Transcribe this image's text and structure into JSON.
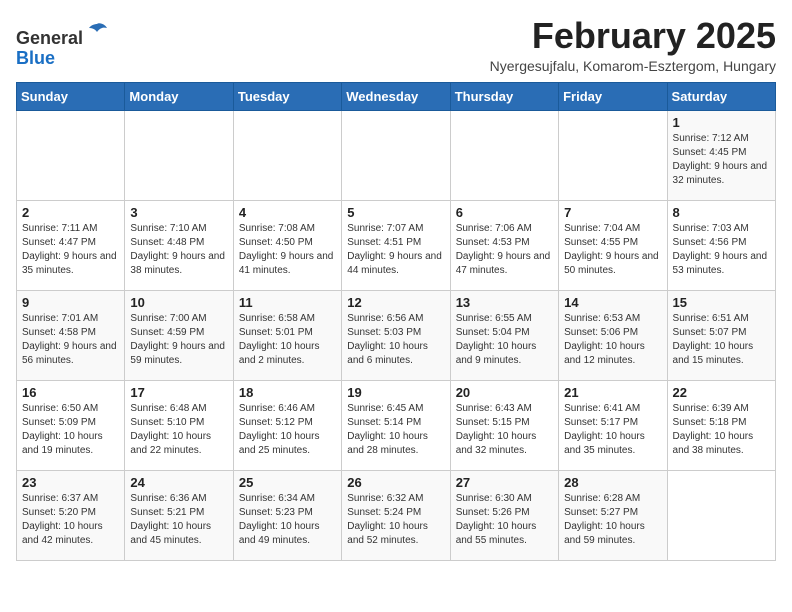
{
  "header": {
    "logo_general": "General",
    "logo_blue": "Blue",
    "title": "February 2025",
    "subtitle": "Nyergesujfalu, Komarom-Esztergom, Hungary"
  },
  "days_of_week": [
    "Sunday",
    "Monday",
    "Tuesday",
    "Wednesday",
    "Thursday",
    "Friday",
    "Saturday"
  ],
  "weeks": [
    [
      {
        "day": "",
        "info": ""
      },
      {
        "day": "",
        "info": ""
      },
      {
        "day": "",
        "info": ""
      },
      {
        "day": "",
        "info": ""
      },
      {
        "day": "",
        "info": ""
      },
      {
        "day": "",
        "info": ""
      },
      {
        "day": "1",
        "info": "Sunrise: 7:12 AM\nSunset: 4:45 PM\nDaylight: 9 hours and 32 minutes."
      }
    ],
    [
      {
        "day": "2",
        "info": "Sunrise: 7:11 AM\nSunset: 4:47 PM\nDaylight: 9 hours and 35 minutes."
      },
      {
        "day": "3",
        "info": "Sunrise: 7:10 AM\nSunset: 4:48 PM\nDaylight: 9 hours and 38 minutes."
      },
      {
        "day": "4",
        "info": "Sunrise: 7:08 AM\nSunset: 4:50 PM\nDaylight: 9 hours and 41 minutes."
      },
      {
        "day": "5",
        "info": "Sunrise: 7:07 AM\nSunset: 4:51 PM\nDaylight: 9 hours and 44 minutes."
      },
      {
        "day": "6",
        "info": "Sunrise: 7:06 AM\nSunset: 4:53 PM\nDaylight: 9 hours and 47 minutes."
      },
      {
        "day": "7",
        "info": "Sunrise: 7:04 AM\nSunset: 4:55 PM\nDaylight: 9 hours and 50 minutes."
      },
      {
        "day": "8",
        "info": "Sunrise: 7:03 AM\nSunset: 4:56 PM\nDaylight: 9 hours and 53 minutes."
      }
    ],
    [
      {
        "day": "9",
        "info": "Sunrise: 7:01 AM\nSunset: 4:58 PM\nDaylight: 9 hours and 56 minutes."
      },
      {
        "day": "10",
        "info": "Sunrise: 7:00 AM\nSunset: 4:59 PM\nDaylight: 9 hours and 59 minutes."
      },
      {
        "day": "11",
        "info": "Sunrise: 6:58 AM\nSunset: 5:01 PM\nDaylight: 10 hours and 2 minutes."
      },
      {
        "day": "12",
        "info": "Sunrise: 6:56 AM\nSunset: 5:03 PM\nDaylight: 10 hours and 6 minutes."
      },
      {
        "day": "13",
        "info": "Sunrise: 6:55 AM\nSunset: 5:04 PM\nDaylight: 10 hours and 9 minutes."
      },
      {
        "day": "14",
        "info": "Sunrise: 6:53 AM\nSunset: 5:06 PM\nDaylight: 10 hours and 12 minutes."
      },
      {
        "day": "15",
        "info": "Sunrise: 6:51 AM\nSunset: 5:07 PM\nDaylight: 10 hours and 15 minutes."
      }
    ],
    [
      {
        "day": "16",
        "info": "Sunrise: 6:50 AM\nSunset: 5:09 PM\nDaylight: 10 hours and 19 minutes."
      },
      {
        "day": "17",
        "info": "Sunrise: 6:48 AM\nSunset: 5:10 PM\nDaylight: 10 hours and 22 minutes."
      },
      {
        "day": "18",
        "info": "Sunrise: 6:46 AM\nSunset: 5:12 PM\nDaylight: 10 hours and 25 minutes."
      },
      {
        "day": "19",
        "info": "Sunrise: 6:45 AM\nSunset: 5:14 PM\nDaylight: 10 hours and 28 minutes."
      },
      {
        "day": "20",
        "info": "Sunrise: 6:43 AM\nSunset: 5:15 PM\nDaylight: 10 hours and 32 minutes."
      },
      {
        "day": "21",
        "info": "Sunrise: 6:41 AM\nSunset: 5:17 PM\nDaylight: 10 hours and 35 minutes."
      },
      {
        "day": "22",
        "info": "Sunrise: 6:39 AM\nSunset: 5:18 PM\nDaylight: 10 hours and 38 minutes."
      }
    ],
    [
      {
        "day": "23",
        "info": "Sunrise: 6:37 AM\nSunset: 5:20 PM\nDaylight: 10 hours and 42 minutes."
      },
      {
        "day": "24",
        "info": "Sunrise: 6:36 AM\nSunset: 5:21 PM\nDaylight: 10 hours and 45 minutes."
      },
      {
        "day": "25",
        "info": "Sunrise: 6:34 AM\nSunset: 5:23 PM\nDaylight: 10 hours and 49 minutes."
      },
      {
        "day": "26",
        "info": "Sunrise: 6:32 AM\nSunset: 5:24 PM\nDaylight: 10 hours and 52 minutes."
      },
      {
        "day": "27",
        "info": "Sunrise: 6:30 AM\nSunset: 5:26 PM\nDaylight: 10 hours and 55 minutes."
      },
      {
        "day": "28",
        "info": "Sunrise: 6:28 AM\nSunset: 5:27 PM\nDaylight: 10 hours and 59 minutes."
      },
      {
        "day": "",
        "info": ""
      }
    ]
  ]
}
